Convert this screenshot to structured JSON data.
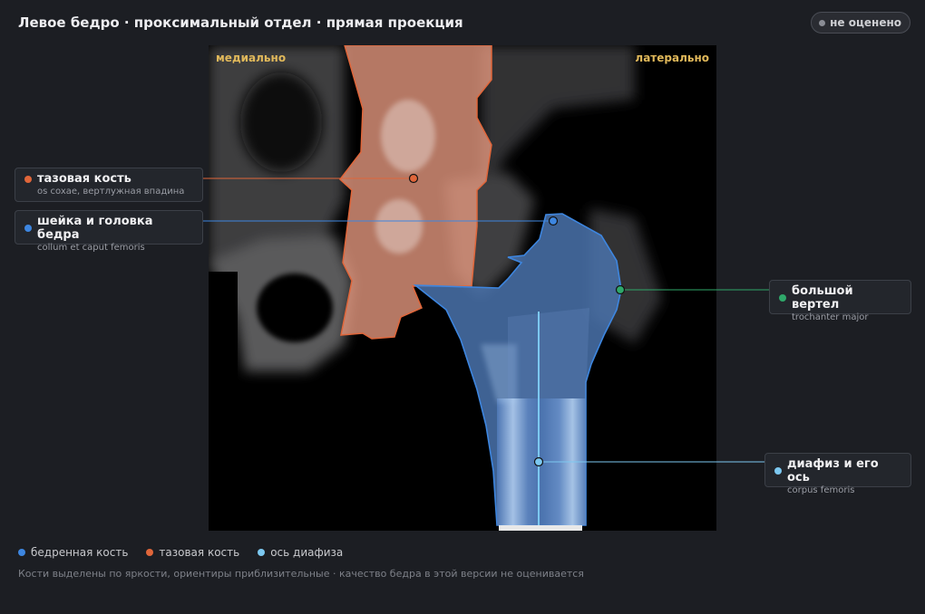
{
  "header": {
    "title": "Левое бедро · проксимальный отдел · прямая проекция"
  },
  "status_badge": {
    "label": "не оценено"
  },
  "viewer": {
    "orientation_left": "медиально",
    "orientation_right": "латерально"
  },
  "callouts": [
    {
      "title": "тазовая кость",
      "subtitle": "os coxae, вертлужная впадина",
      "color": "#e0663a"
    },
    {
      "title": "шейка и головка бедра",
      "subtitle": "collum et caput femoris",
      "color": "#3d86e0"
    },
    {
      "title": "большой вертел",
      "subtitle": "trochanter major",
      "color": "#2fa86a"
    },
    {
      "title": "диафиз и его ось",
      "subtitle": "corpus femoris",
      "color": "#7cc8f0"
    }
  ],
  "legend": [
    {
      "label": "бедренная кость",
      "color": "#3d86e0"
    },
    {
      "label": "тазовая кость",
      "color": "#e0663a"
    },
    {
      "label": "ось диафиза",
      "color": "#7cc8f0"
    }
  ],
  "footer_note": "Кости выделены по яркости, ориентиры приблизительные · качество бедра в этой версии не оценивается"
}
